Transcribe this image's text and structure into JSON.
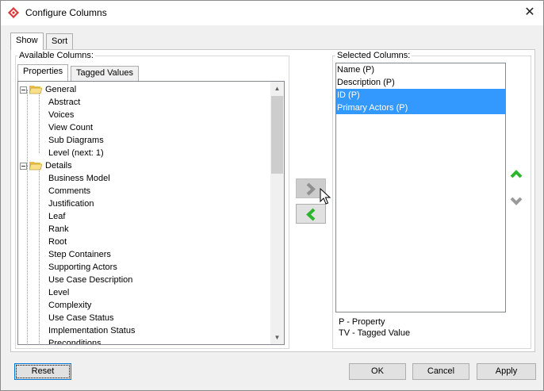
{
  "window": {
    "title": "Configure Columns",
    "app_icon": "vp-diamond-icon",
    "close_glyph": "✕"
  },
  "outer_tabs": [
    {
      "label": "Show",
      "active": true
    },
    {
      "label": "Sort",
      "active": false
    }
  ],
  "available": {
    "label": "Available Columns:",
    "tabs": [
      {
        "label": "Properties",
        "active": true
      },
      {
        "label": "Tagged Values",
        "active": false
      }
    ],
    "general": {
      "label": "General",
      "items": [
        "Abstract",
        "Voices",
        "View Count",
        "Sub Diagrams",
        "Level (next: 1)"
      ]
    },
    "details": {
      "label": "Details",
      "items": [
        "Business Model",
        "Comments",
        "Justification",
        "Leaf",
        "Rank",
        "Root",
        "Step Containers",
        "Supporting Actors",
        "Use Case Description",
        "Level",
        "Complexity",
        "Use Case Status",
        "Implementation Status",
        "Preconditions"
      ]
    }
  },
  "selected": {
    "label": "Selected Columns:",
    "items": [
      {
        "label": "Name (P)",
        "selected": false
      },
      {
        "label": "Description (P)",
        "selected": false
      },
      {
        "label": "ID (P)",
        "selected": true
      },
      {
        "label": "Primary Actors (P)",
        "selected": true
      }
    ]
  },
  "legend": {
    "property": "P - Property",
    "tagged": "TV - Tagged Value"
  },
  "buttons": {
    "reset": "Reset",
    "ok": "OK",
    "cancel": "Cancel",
    "apply": "Apply"
  },
  "colors": {
    "selection": "#3399ff",
    "arrow_green": "#2db52d",
    "folder_yellow": "#f4d35e"
  }
}
